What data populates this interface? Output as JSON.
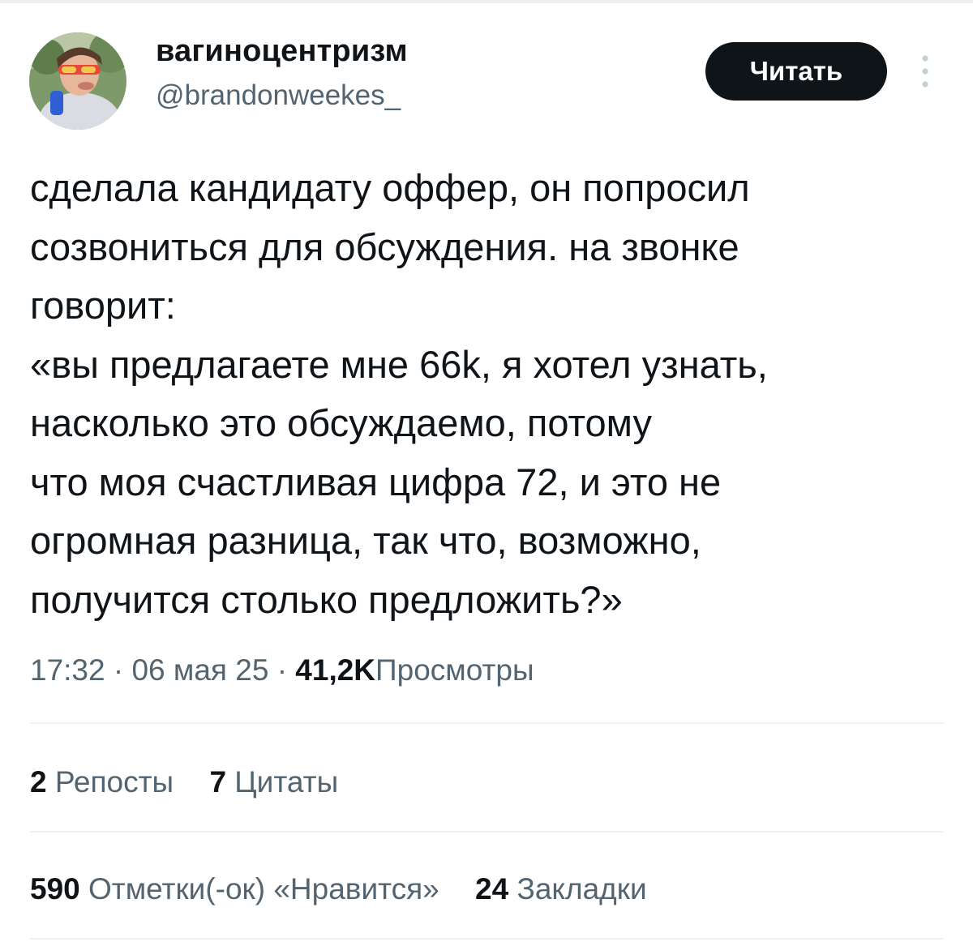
{
  "tweet": {
    "author": {
      "display_name": "вагиноцентризм",
      "handle": "@brandonweekes_"
    },
    "follow_label": "Читать",
    "text_lines": [
      "сделала кандидату оффер, он попросил",
      "созвониться для обсуждения. на звонке",
      "говорит:",
      "«вы предлагаете мне 66k, я хотел узнать,",
      "насколько это обсуждаемо, потому",
      "что моя счастливая цифра 72, и это не",
      "огромная разница, так что, возможно,",
      "получится столько предложить?»"
    ],
    "time": "17:32",
    "date": "06 мая 25",
    "separator": "·",
    "views_count": "41,2K",
    "views_label": "Просмотры",
    "stats": {
      "reposts_count": "2",
      "reposts_label": "Репосты",
      "quotes_count": "7",
      "quotes_label": "Цитаты",
      "likes_count": "590",
      "likes_label": "Отметки(-ок) «Нравится»",
      "bookmarks_count": "24",
      "bookmarks_label": "Закладки"
    }
  },
  "icons": {
    "more": "more-vertical-icon"
  },
  "colors": {
    "text_primary": "#0f1419",
    "text_secondary": "#536471",
    "button_bg": "#0f1419",
    "button_text": "#ffffff",
    "divider": "#eff3f4"
  }
}
